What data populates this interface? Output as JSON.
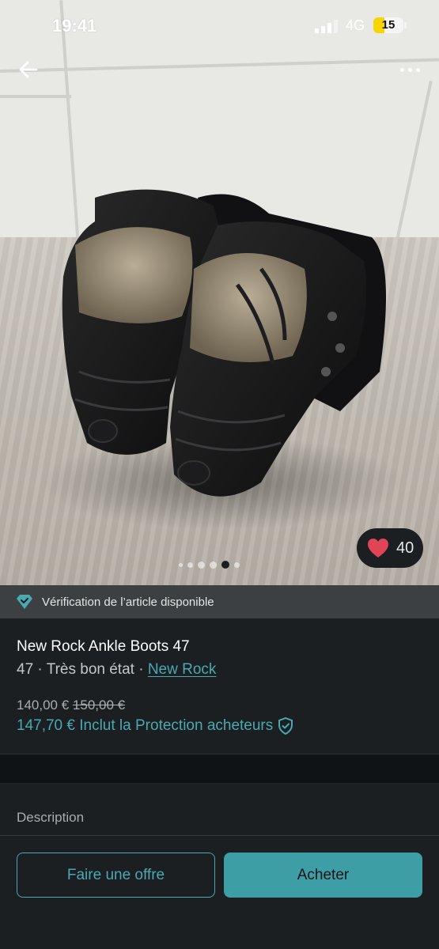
{
  "status_bar": {
    "time": "19:41",
    "network": "4G",
    "battery": "15",
    "battery_color": "#f6d500"
  },
  "nav": {
    "back_icon": "arrow-left-icon",
    "more_icon": "more-horizontal-icon"
  },
  "gallery": {
    "dots_count": 6,
    "active_index": 4,
    "likes": "40",
    "like_icon": "heart-icon",
    "like_color": "#e24457"
  },
  "verification": {
    "text": "Vérification de l’article disponible",
    "icon": "diamond-check-icon"
  },
  "item": {
    "title": "New Rock Ankle Boots 47",
    "size": "47",
    "separator": "·",
    "condition": "Très bon état",
    "brand": "New Rock",
    "price": "140,00 €",
    "old_price": "150,00 €",
    "total": "147,70 € Inclut la Protection acheteurs",
    "shield_icon": "shield-check-icon"
  },
  "description": {
    "label": "Description"
  },
  "actions": {
    "offer_label": "Faire une offre",
    "buy_label": "Acheter"
  },
  "colors": {
    "accent": "#4aa9b0",
    "background": "#1b1f22"
  }
}
